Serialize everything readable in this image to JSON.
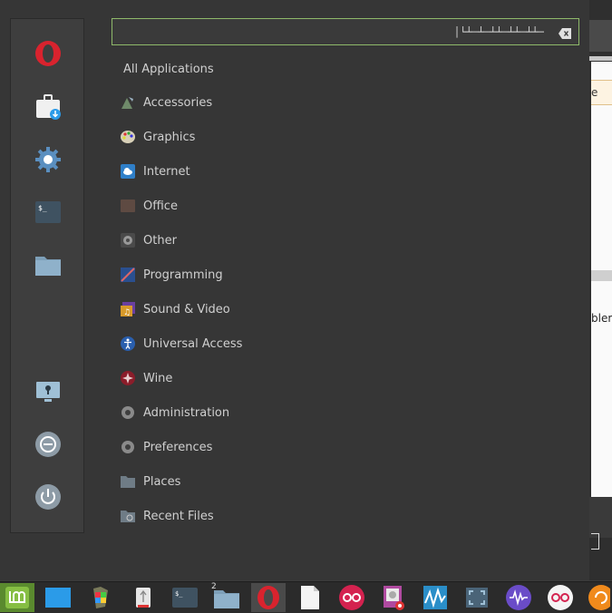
{
  "background_window": {
    "highlight_fragment": "e",
    "text_fragment": "blem"
  },
  "search": {
    "value": "│└┴─┴─┴┴─┴┴─┴┴─"
  },
  "menu": {
    "all_applications": "All Applications",
    "categories": [
      {
        "label": "Accessories",
        "icon": "accessories-icon"
      },
      {
        "label": "Graphics",
        "icon": "graphics-icon"
      },
      {
        "label": "Internet",
        "icon": "internet-icon"
      },
      {
        "label": "Office",
        "icon": "office-icon"
      },
      {
        "label": "Other",
        "icon": "other-icon"
      },
      {
        "label": "Programming",
        "icon": "programming-icon"
      },
      {
        "label": "Sound & Video",
        "icon": "sound-video-icon"
      },
      {
        "label": "Universal Access",
        "icon": "universal-access-icon"
      },
      {
        "label": "Wine",
        "icon": "wine-icon"
      },
      {
        "label": "Administration",
        "icon": "administration-icon"
      },
      {
        "label": "Preferences",
        "icon": "preferences-icon"
      },
      {
        "label": "Places",
        "icon": "places-icon"
      },
      {
        "label": "Recent Files",
        "icon": "recent-files-icon"
      }
    ]
  },
  "sidebar": {
    "favorites": [
      "opera-icon",
      "software-manager-icon",
      "system-settings-icon",
      "terminal-icon",
      "files-icon"
    ],
    "session": [
      "lock-screen-icon",
      "logout-icon",
      "shutdown-icon"
    ]
  },
  "taskbar": {
    "files_badge": "2"
  },
  "colors": {
    "search_border": "#8fb96a",
    "opera_red": "#d9232e",
    "mint_green": "#86be43",
    "accent_blue": "#2b9be8"
  }
}
